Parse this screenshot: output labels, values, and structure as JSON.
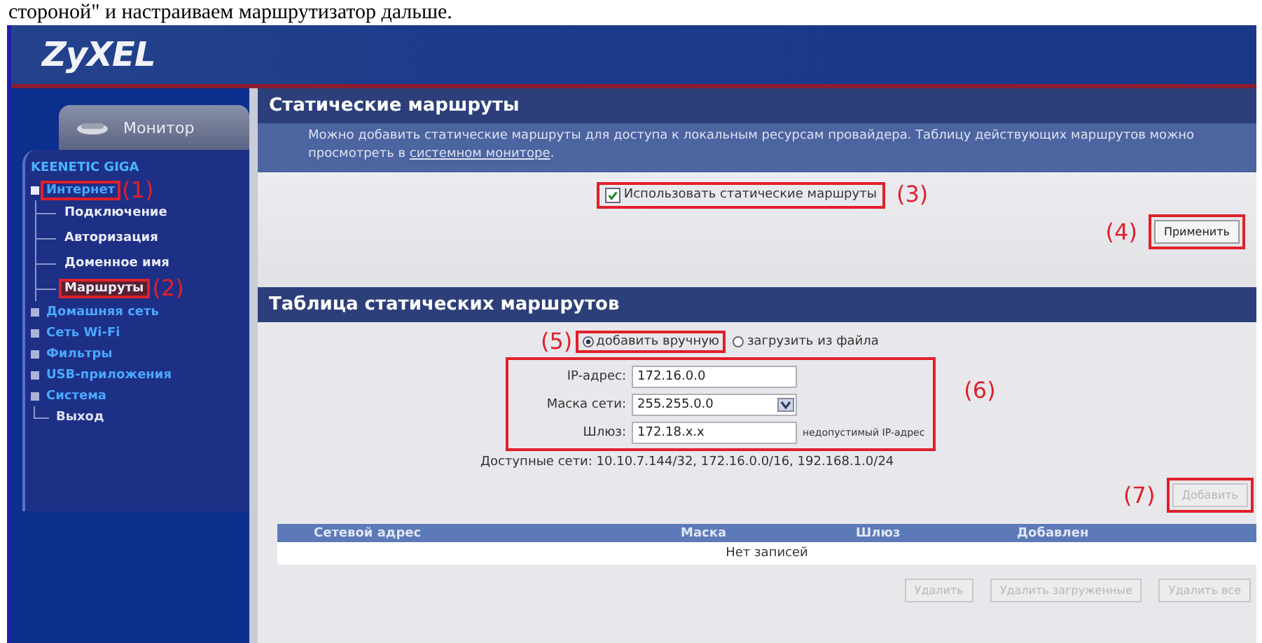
{
  "caption": "стороной\" и настраиваем маршрутизатор дальше.",
  "header": {
    "logo": "ZyXEL"
  },
  "sidebar": {
    "monitor_tab": "Монитор",
    "device": "KEENETIC GIGA",
    "items": [
      {
        "kind": "group",
        "label": "Интернет",
        "expanded": true,
        "highlighted": true,
        "note": "(1)",
        "children": [
          {
            "label": "Подключение",
            "selected": false,
            "highlighted": false
          },
          {
            "label": "Авторизация",
            "selected": false,
            "highlighted": false
          },
          {
            "label": "Доменное имя",
            "selected": false,
            "highlighted": false
          },
          {
            "label": "Маршруты",
            "selected": true,
            "highlighted": true,
            "note": "(2)"
          }
        ]
      },
      {
        "kind": "group",
        "label": "Домашняя сеть",
        "expanded": false,
        "highlighted": false
      },
      {
        "kind": "group",
        "label": "Сеть Wi-Fi",
        "expanded": false,
        "highlighted": false
      },
      {
        "kind": "group",
        "label": "Фильтры",
        "expanded": false,
        "highlighted": false
      },
      {
        "kind": "group",
        "label": "USB-приложения",
        "expanded": false,
        "highlighted": false
      },
      {
        "kind": "group",
        "label": "Система",
        "expanded": false,
        "highlighted": false
      },
      {
        "kind": "link",
        "label": "Выход",
        "highlighted": false
      }
    ]
  },
  "static_routes": {
    "title": "Статические маршруты",
    "description": "Можно добавить статические маршруты для доступа к локальным ресурсам провайдера. Таблицу действующих маршрутов можно просмотреть в ",
    "description_link": "системном мониторе",
    "description_end": ".",
    "use_checkbox": {
      "label": "Использовать статические маршруты",
      "checked": true,
      "highlighted": true,
      "note": "(3)"
    },
    "apply_button": {
      "label": "Применить",
      "disabled": false,
      "highlighted": true,
      "note": "(4)"
    }
  },
  "route_table": {
    "title": "Таблица статических маршрутов",
    "modes_note": "(5)",
    "modes": [
      {
        "label": "добавить вручную",
        "selected": true,
        "highlighted": true
      },
      {
        "label": "загрузить из файла",
        "selected": false,
        "highlighted": false
      }
    ],
    "fields_note": "(6)",
    "fields_highlighted": true,
    "fields": [
      {
        "kind": "text",
        "label": "IP-адрес:",
        "value": "172.16.0.0"
      },
      {
        "kind": "select",
        "label": "Маска сети:",
        "value": "255.255.0.0"
      },
      {
        "kind": "text",
        "label": "Шлюз:",
        "value": "172.18.x.x",
        "error": "недопустимый IP-адрес"
      }
    ],
    "available": "Доступные сети: 10.10.7.144/32, 172.16.0.0/16, 192.168.1.0/24",
    "add_button": {
      "label": "Добавить",
      "disabled": true,
      "highlighted": true,
      "note": "(7)"
    },
    "columns": [
      "Сетевой адрес",
      "Маска",
      "Шлюз",
      "Добавлен"
    ],
    "empty": "Нет записей",
    "actions": [
      {
        "label": "Удалить",
        "disabled": true
      },
      {
        "label": "Удалить загруженные",
        "disabled": true
      },
      {
        "label": "Удалить все",
        "disabled": true
      }
    ]
  }
}
